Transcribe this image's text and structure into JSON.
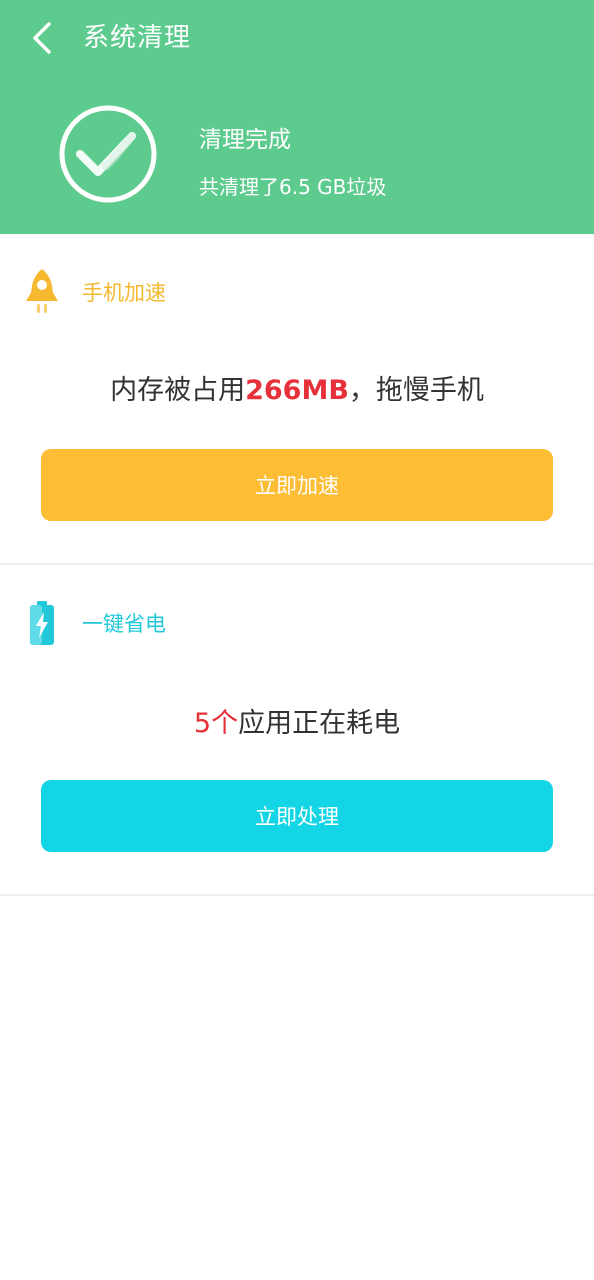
{
  "header": {
    "title": "系统清理",
    "status_title": "清理完成",
    "status_subtitle": "共清理了6.5 GB垃圾"
  },
  "speed_card": {
    "label": "手机加速",
    "message_prefix": "内存被占用",
    "message_highlight": "266MB",
    "message_suffix": "，拖慢手机",
    "button_label": "立即加速"
  },
  "power_card": {
    "label": "一键省电",
    "message_highlight": "5个",
    "message_suffix": "应用正在耗电",
    "button_label": "立即处理"
  },
  "colors": {
    "header_bg": "#5ecb8e",
    "speed_accent": "#fdbd35",
    "power_accent": "#14d5e5",
    "highlight": "#e6303a"
  },
  "icons": {
    "back": "chevron-left-icon",
    "done": "check-circle-icon",
    "speed": "rocket-icon",
    "power": "battery-icon"
  }
}
